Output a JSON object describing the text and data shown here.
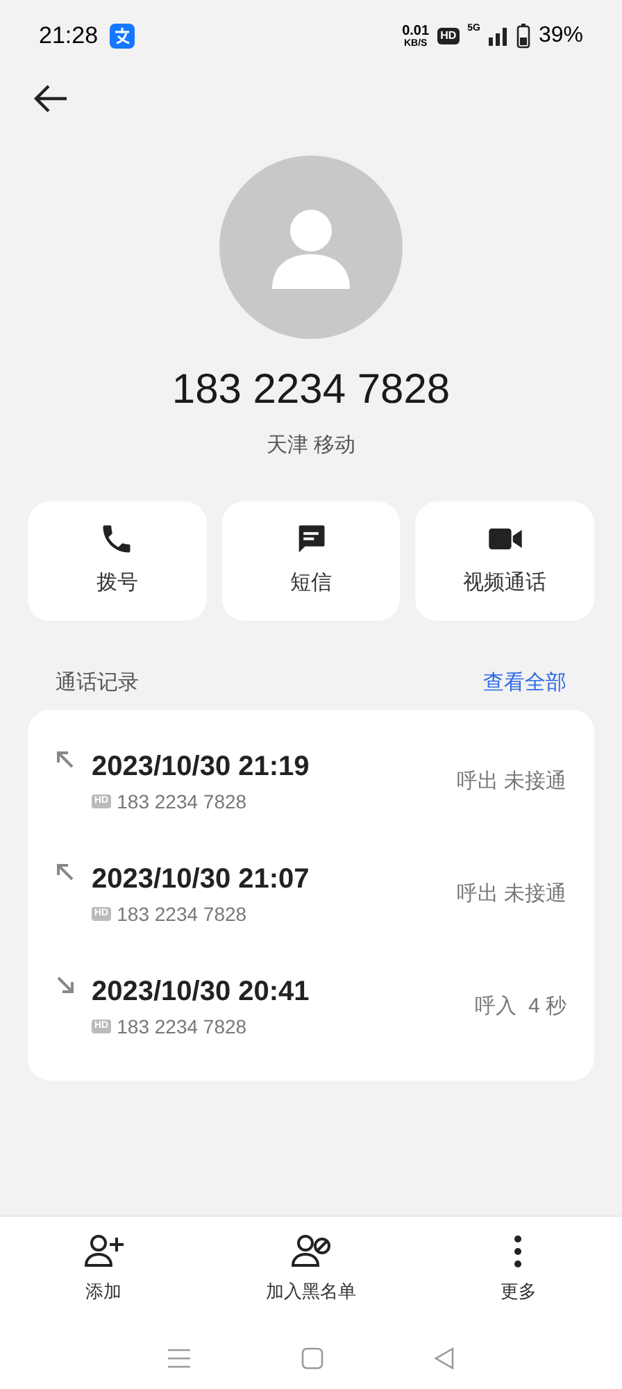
{
  "status_bar": {
    "time": "21:28",
    "speed": "0.01",
    "speed_unit": "KB/S",
    "hd": "HD",
    "network": "5G",
    "battery": "39%"
  },
  "contact": {
    "number": "183 2234 7828",
    "location": "天津 移动"
  },
  "actions": [
    {
      "kind": "phone",
      "label": "拨号"
    },
    {
      "kind": "message",
      "label": "短信"
    },
    {
      "kind": "video",
      "label": "视频通话"
    }
  ],
  "call_log": {
    "title": "通话记录",
    "view_all": "查看全部",
    "entries": [
      {
        "kind": "outgoing",
        "time": "2023/10/30 21:19",
        "hd": "HD",
        "number": "183 2234 7828",
        "status": "呼出 未接通"
      },
      {
        "kind": "outgoing",
        "time": "2023/10/30 21:07",
        "hd": "HD",
        "number": "183 2234 7828",
        "status": "呼出 未接通"
      },
      {
        "kind": "incoming",
        "time": "2023/10/30 20:41",
        "hd": "HD",
        "number": "183 2234 7828",
        "status": "呼入  4 秒"
      }
    ]
  },
  "bottom_actions": [
    {
      "kind": "add",
      "label": "添加"
    },
    {
      "kind": "block",
      "label": "加入黑名单"
    },
    {
      "kind": "more",
      "label": "更多"
    }
  ]
}
